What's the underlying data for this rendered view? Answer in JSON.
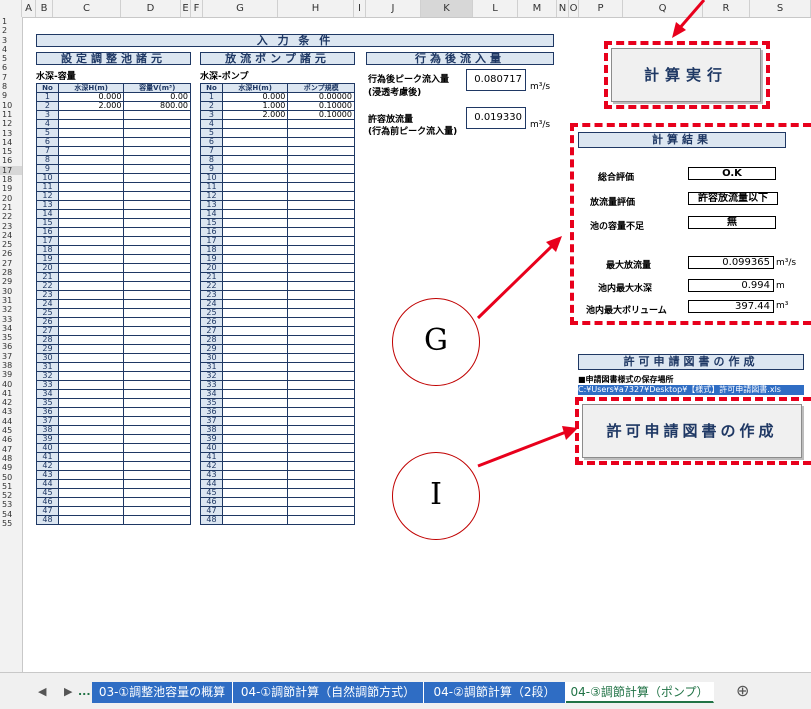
{
  "columns": [
    "A",
    "B",
    "C",
    "D",
    "E",
    "F",
    "G",
    "H",
    "I",
    "J",
    "K",
    "L",
    "M",
    "N",
    "O",
    "P",
    "Q",
    "R",
    "S"
  ],
  "rows": [
    "1",
    "2",
    "3",
    "4",
    "5",
    "6",
    "7",
    "8",
    "9",
    "10",
    "11",
    "12",
    "13",
    "14",
    "15",
    "16",
    "17",
    "18",
    "19",
    "20",
    "21",
    "22",
    "23",
    "24",
    "25",
    "26",
    "27",
    "28",
    "29",
    "30",
    "31",
    "32",
    "33",
    "34",
    "35",
    "36",
    "37",
    "38",
    "39",
    "40",
    "41",
    "42",
    "43",
    "44",
    "45",
    "46",
    "47",
    "48",
    "49",
    "50",
    "51",
    "52",
    "53",
    "54",
    "55"
  ],
  "sheet": {
    "title": "入 力 条 件",
    "reservoir": {
      "section_title": "設定調整池諸元",
      "subtitle": "水深-容量",
      "headers": [
        "No",
        "水深H(m)",
        "容量V(m³)"
      ],
      "rows": [
        [
          "1",
          "0.000",
          "0.00"
        ],
        [
          "2",
          "2.000",
          "800.00"
        ]
      ]
    },
    "pump": {
      "section_title": "放流ポンプ諸元",
      "subtitle": "水深-ポンプ",
      "headers": [
        "No",
        "水深H(m)",
        "ポンプ規模"
      ],
      "rows": [
        [
          "1",
          "0.000",
          "0.00000"
        ],
        [
          "2",
          "1.000",
          "0.10000"
        ],
        [
          "3",
          "2.000",
          "0.10000"
        ]
      ]
    },
    "row_numbers": [
      "1",
      "2",
      "3",
      "4",
      "5",
      "6",
      "7",
      "8",
      "9",
      "10",
      "11",
      "12",
      "13",
      "14",
      "15",
      "16",
      "17",
      "18",
      "19",
      "20",
      "21",
      "22",
      "23",
      "24",
      "25",
      "26",
      "27",
      "28",
      "29",
      "30",
      "31",
      "32",
      "33",
      "34",
      "35",
      "36",
      "37",
      "38",
      "39",
      "40",
      "41",
      "42",
      "43",
      "44",
      "45",
      "46",
      "47",
      "48"
    ],
    "inflow": {
      "section_title": "行為後流入量",
      "peak_label_1": "行為後ピーク流入量",
      "peak_label_2": "(浸透考慮後)",
      "peak_value": "0.080717",
      "allow_label_1": "許容放流量",
      "allow_label_2": "(行為前ピーク流入量)",
      "allow_value": "0.019330",
      "unit": "m³/s"
    },
    "calc_button": "計算実行",
    "results": {
      "section_title": "計算結果",
      "overall_label": "総合評価",
      "overall_value": "O.K",
      "discharge_eval_label": "放流量評価",
      "discharge_eval_value": "許容放流量以下",
      "shortage_label": "池の容量不足",
      "shortage_value": "無",
      "max_discharge_label": "最大放流量",
      "max_discharge_value": "0.099365",
      "max_discharge_unit": "m³/s",
      "max_depth_label": "池内最大水深",
      "max_depth_value": "0.994",
      "max_depth_unit": "m",
      "max_volume_label": "池内最大ボリューム",
      "max_volume_value": "397.44",
      "max_volume_unit": "m³"
    },
    "permit": {
      "section_title": "許可申請図書の作成",
      "path_label": "■申請図書様式の保存場所",
      "path_value": "C:¥Users¥a7327¥Desktop¥【様式】許可申請図書.xls",
      "button": "許可申請図書の作成"
    }
  },
  "annotations": {
    "g": "G",
    "i": "I",
    "color": "#e8001c"
  },
  "tabs": {
    "ellipsis": "...",
    "items": [
      "03-①調整池容量の概算",
      "04-①調節計算（自然調節方式）",
      "04-②調節計算（2段）",
      "04-③調節計算（ポンプ）"
    ],
    "active_index": 3,
    "add": "⊕"
  }
}
